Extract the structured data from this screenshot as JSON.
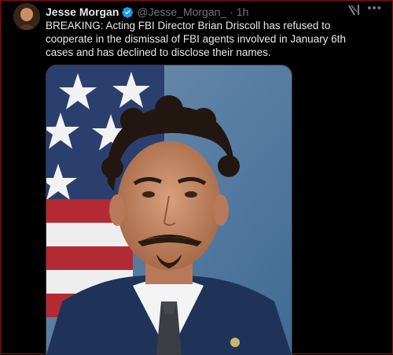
{
  "tweet": {
    "author_name": "Jesse Morgan",
    "handle": "@Jesse_Morgan_",
    "separator": "·",
    "time": "1h",
    "text": "BREAKING: Acting FBI Director Brian Driscoll has refused to cooperate in the dismissal of FBI agents involved in January 6th cases and has declined to disclose their names.",
    "more_label": "•••"
  },
  "icons": {
    "verified": "verified-badge-icon",
    "grok": "grok-icon",
    "more": "more-options-icon"
  },
  "colors": {
    "background": "#000000",
    "text_primary": "#e7e9ea",
    "text_secondary": "#71767b",
    "verified_blue": "#1d9bf0"
  }
}
